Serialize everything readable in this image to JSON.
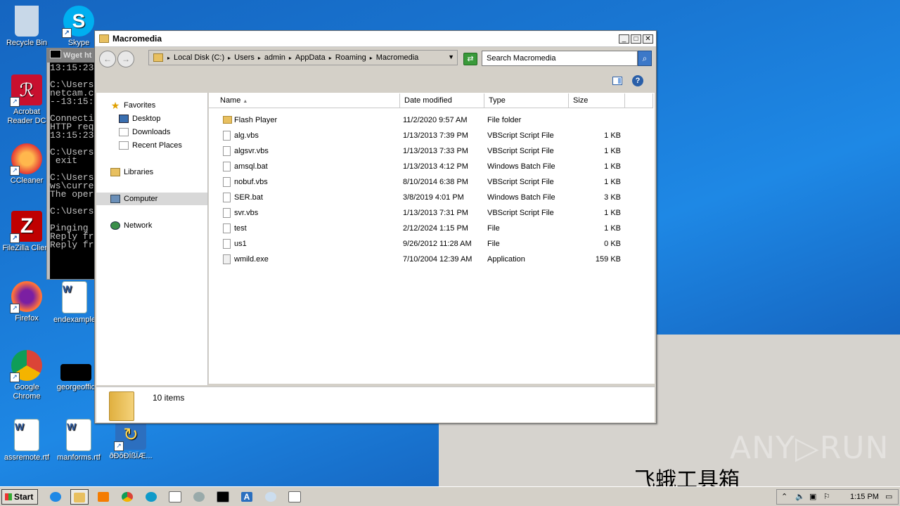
{
  "desktop": {
    "icons": [
      {
        "label": "Recycle Bin",
        "color": "#c8d8e8"
      },
      {
        "label": "Skype",
        "color": "#00aff0"
      },
      {
        "label": "Acrobat Reader DC",
        "color": "#c8102e"
      },
      {
        "label": "CCleaner",
        "color": "#e53935"
      },
      {
        "label": "FileZilla Client",
        "color": "#bf0000"
      },
      {
        "label": "Firefox",
        "color": "#ff7139"
      },
      {
        "label": "endexample",
        "color": "#ffffff"
      },
      {
        "label": "Google Chrome",
        "color": "#4285f4"
      },
      {
        "label": "georgeoffic",
        "color": "#000000"
      },
      {
        "label": "assremote.rtf",
        "color": "#ffffff"
      },
      {
        "label": "manforms.rtf",
        "color": "#ffffff"
      },
      {
        "label": "ðÐõÐÏßÏÆ...",
        "color": "#2c6fbf"
      }
    ]
  },
  "console": {
    "title": "Wget ht",
    "lines": [
      "13:15:23",
      "",
      "C:\\Users",
      "netcam.c",
      "--13:15:",
      "",
      "Connecti",
      "HTTP req",
      "13:15:23",
      "",
      "C:\\Users",
      " exit",
      "",
      "C:\\Users",
      "ws\\curre",
      "The oper",
      "",
      "C:\\Users",
      "",
      "Pinging ",
      "Reply fr",
      "Reply fr"
    ]
  },
  "explorer": {
    "title": "Macromedia",
    "breadcrumb": [
      "Local Disk (C:)",
      "Users",
      "admin",
      "AppData",
      "Roaming",
      "Macromedia"
    ],
    "search_placeholder": "Search Macromedia",
    "nav": {
      "favorites": "Favorites",
      "desktop": "Desktop",
      "downloads": "Downloads",
      "recent": "Recent Places",
      "libraries": "Libraries",
      "computer": "Computer",
      "network": "Network"
    },
    "columns": {
      "name": "Name",
      "date": "Date modified",
      "type": "Type",
      "size": "Size"
    },
    "files": [
      {
        "name": "Flash Player",
        "date": "11/2/2020 9:57 AM",
        "type": "File folder",
        "size": ""
      },
      {
        "name": "alg.vbs",
        "date": "1/13/2013 7:39 PM",
        "type": "VBScript Script File",
        "size": "1 KB"
      },
      {
        "name": "algsvr.vbs",
        "date": "1/13/2013 7:33 PM",
        "type": "VBScript Script File",
        "size": "1 KB"
      },
      {
        "name": "amsql.bat",
        "date": "1/13/2013 4:12 PM",
        "type": "Windows Batch File",
        "size": "1 KB"
      },
      {
        "name": "nobuf.vbs",
        "date": "8/10/2014 6:38 PM",
        "type": "VBScript Script File",
        "size": "1 KB"
      },
      {
        "name": "SER.bat",
        "date": "3/8/2019 4:01 PM",
        "type": "Windows Batch File",
        "size": "3 KB"
      },
      {
        "name": "svr.vbs",
        "date": "1/13/2013 7:31 PM",
        "type": "VBScript Script File",
        "size": "1 KB"
      },
      {
        "name": "test",
        "date": "2/12/2024 1:15 PM",
        "type": "File",
        "size": "1 KB"
      },
      {
        "name": "us1",
        "date": "9/26/2012 11:28 AM",
        "type": "File",
        "size": "0 KB"
      },
      {
        "name": "wmild.exe",
        "date": "7/10/2004 12:39 AM",
        "type": "Application",
        "size": "159 KB"
      }
    ],
    "status": "10 items"
  },
  "taskbar": {
    "start": "Start",
    "clock": "1:15 PM"
  },
  "watermark": {
    "anyrun": "ANY▷RUN",
    "cn": "飞蛾工具箱"
  }
}
